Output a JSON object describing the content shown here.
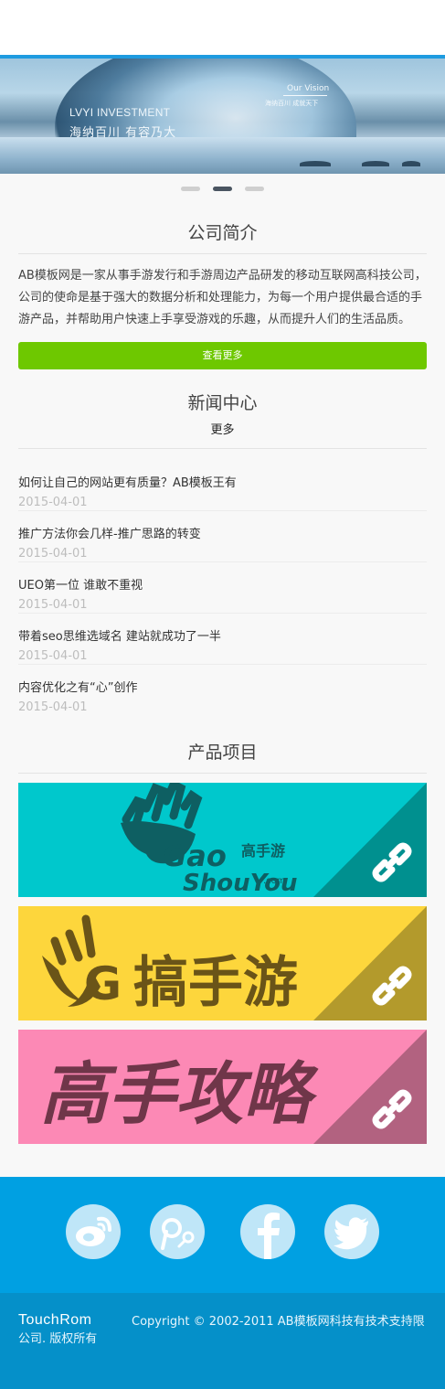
{
  "banner": {
    "en_title": "LVYI INVESTMENT",
    "cn_title": "海纳百川  有容乃大",
    "vision": "Our Vision",
    "vision_sub": "海纳百川    成就天下"
  },
  "slider": {
    "slides": 3,
    "active": 2
  },
  "about": {
    "title": "公司简介",
    "text": "AB模板网是一家从事手游发行和手游周边产品研发的移动互联网高科技公司，公司的使命是基于强大的数据分析和处理能力，为每一个用户提供最合适的手游产品，并帮助用户快速上手享受游戏的乐趣，从而提升人们的生活品质。",
    "button": "查看更多"
  },
  "news": {
    "title": "新闻中心",
    "more": "更多",
    "items": [
      {
        "title": "如何让自己的网站更有质量？AB模板王有",
        "date": "2015-04-01"
      },
      {
        "title": "推广方法你会几样-推广思路的转变",
        "date": "2015-04-01"
      },
      {
        "title": "UEO第一位 谁敢不重视",
        "date": "2015-04-01"
      },
      {
        "title": "带着seo思维选域名 建站就成功了一半",
        "date": "2015-04-01"
      },
      {
        "title": "内容优化之有“心”创作",
        "date": "2015-04-01"
      }
    ]
  },
  "products": {
    "title": "产品项目",
    "items": [
      {
        "name": "Gao高手游 ShouYou.com",
        "logo_line1": "Gao",
        "logo_cn": "高手游",
        "logo_line2": "ShouYou",
        "logo_dom": ".com",
        "bg": "#00c8cc",
        "corner": "#00908f",
        "icon": "gaoshouyou-hand-logo"
      },
      {
        "name": "G搞手游",
        "logo_text": "搞手游",
        "logo_g": "G",
        "bg": "#fdd63c",
        "corner": "#b39a2c",
        "icon": "gaoshouyou-yellow-logo"
      },
      {
        "name": "高手攻略",
        "logo_text": "高手攻略",
        "bg": "#fc89b5",
        "corner": "#b26280",
        "icon": "gaoshou-gonglue-logo"
      }
    ]
  },
  "footer": {
    "social": [
      "weibo-icon",
      "tencent-weibo-icon",
      "facebook-icon",
      "twitter-icon"
    ],
    "logo": "TouchRom",
    "copyright": "Copyright © 2002-2011 AB模板网科技有技术支持限公司. 版权所有"
  },
  "colors": {
    "accent": "#1e9be0",
    "button": "#6ec800",
    "footer": "#00a0e2",
    "footer_bottom": "#0590c9"
  }
}
